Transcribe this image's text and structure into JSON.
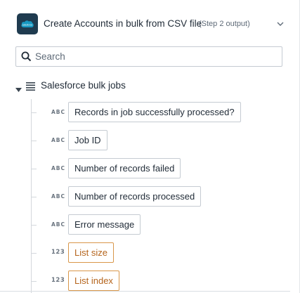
{
  "header": {
    "title": "Create Accounts in bulk from CSV file",
    "subtitle": "(Step 2 output)",
    "logo_icon": "salesforce-cloud-icon",
    "collapse_icon": "chevron-down-icon"
  },
  "search": {
    "placeholder": "Search",
    "value": ""
  },
  "tree": {
    "root_label": "Salesforce bulk jobs",
    "items": [
      {
        "type": "ABC",
        "label": "Records in job successfully processed?"
      },
      {
        "type": "ABC",
        "label": "Job ID"
      },
      {
        "type": "ABC",
        "label": "Number of records failed"
      },
      {
        "type": "ABC",
        "label": "Number of records processed"
      },
      {
        "type": "ABC",
        "label": "Error message"
      },
      {
        "type": "123",
        "label": "List size"
      },
      {
        "type": "123",
        "label": "List index"
      }
    ]
  },
  "colors": {
    "logo_bg": "#1f3b4f",
    "salesforce_blue": "#1798c1",
    "number_accent": "#d9974a"
  }
}
